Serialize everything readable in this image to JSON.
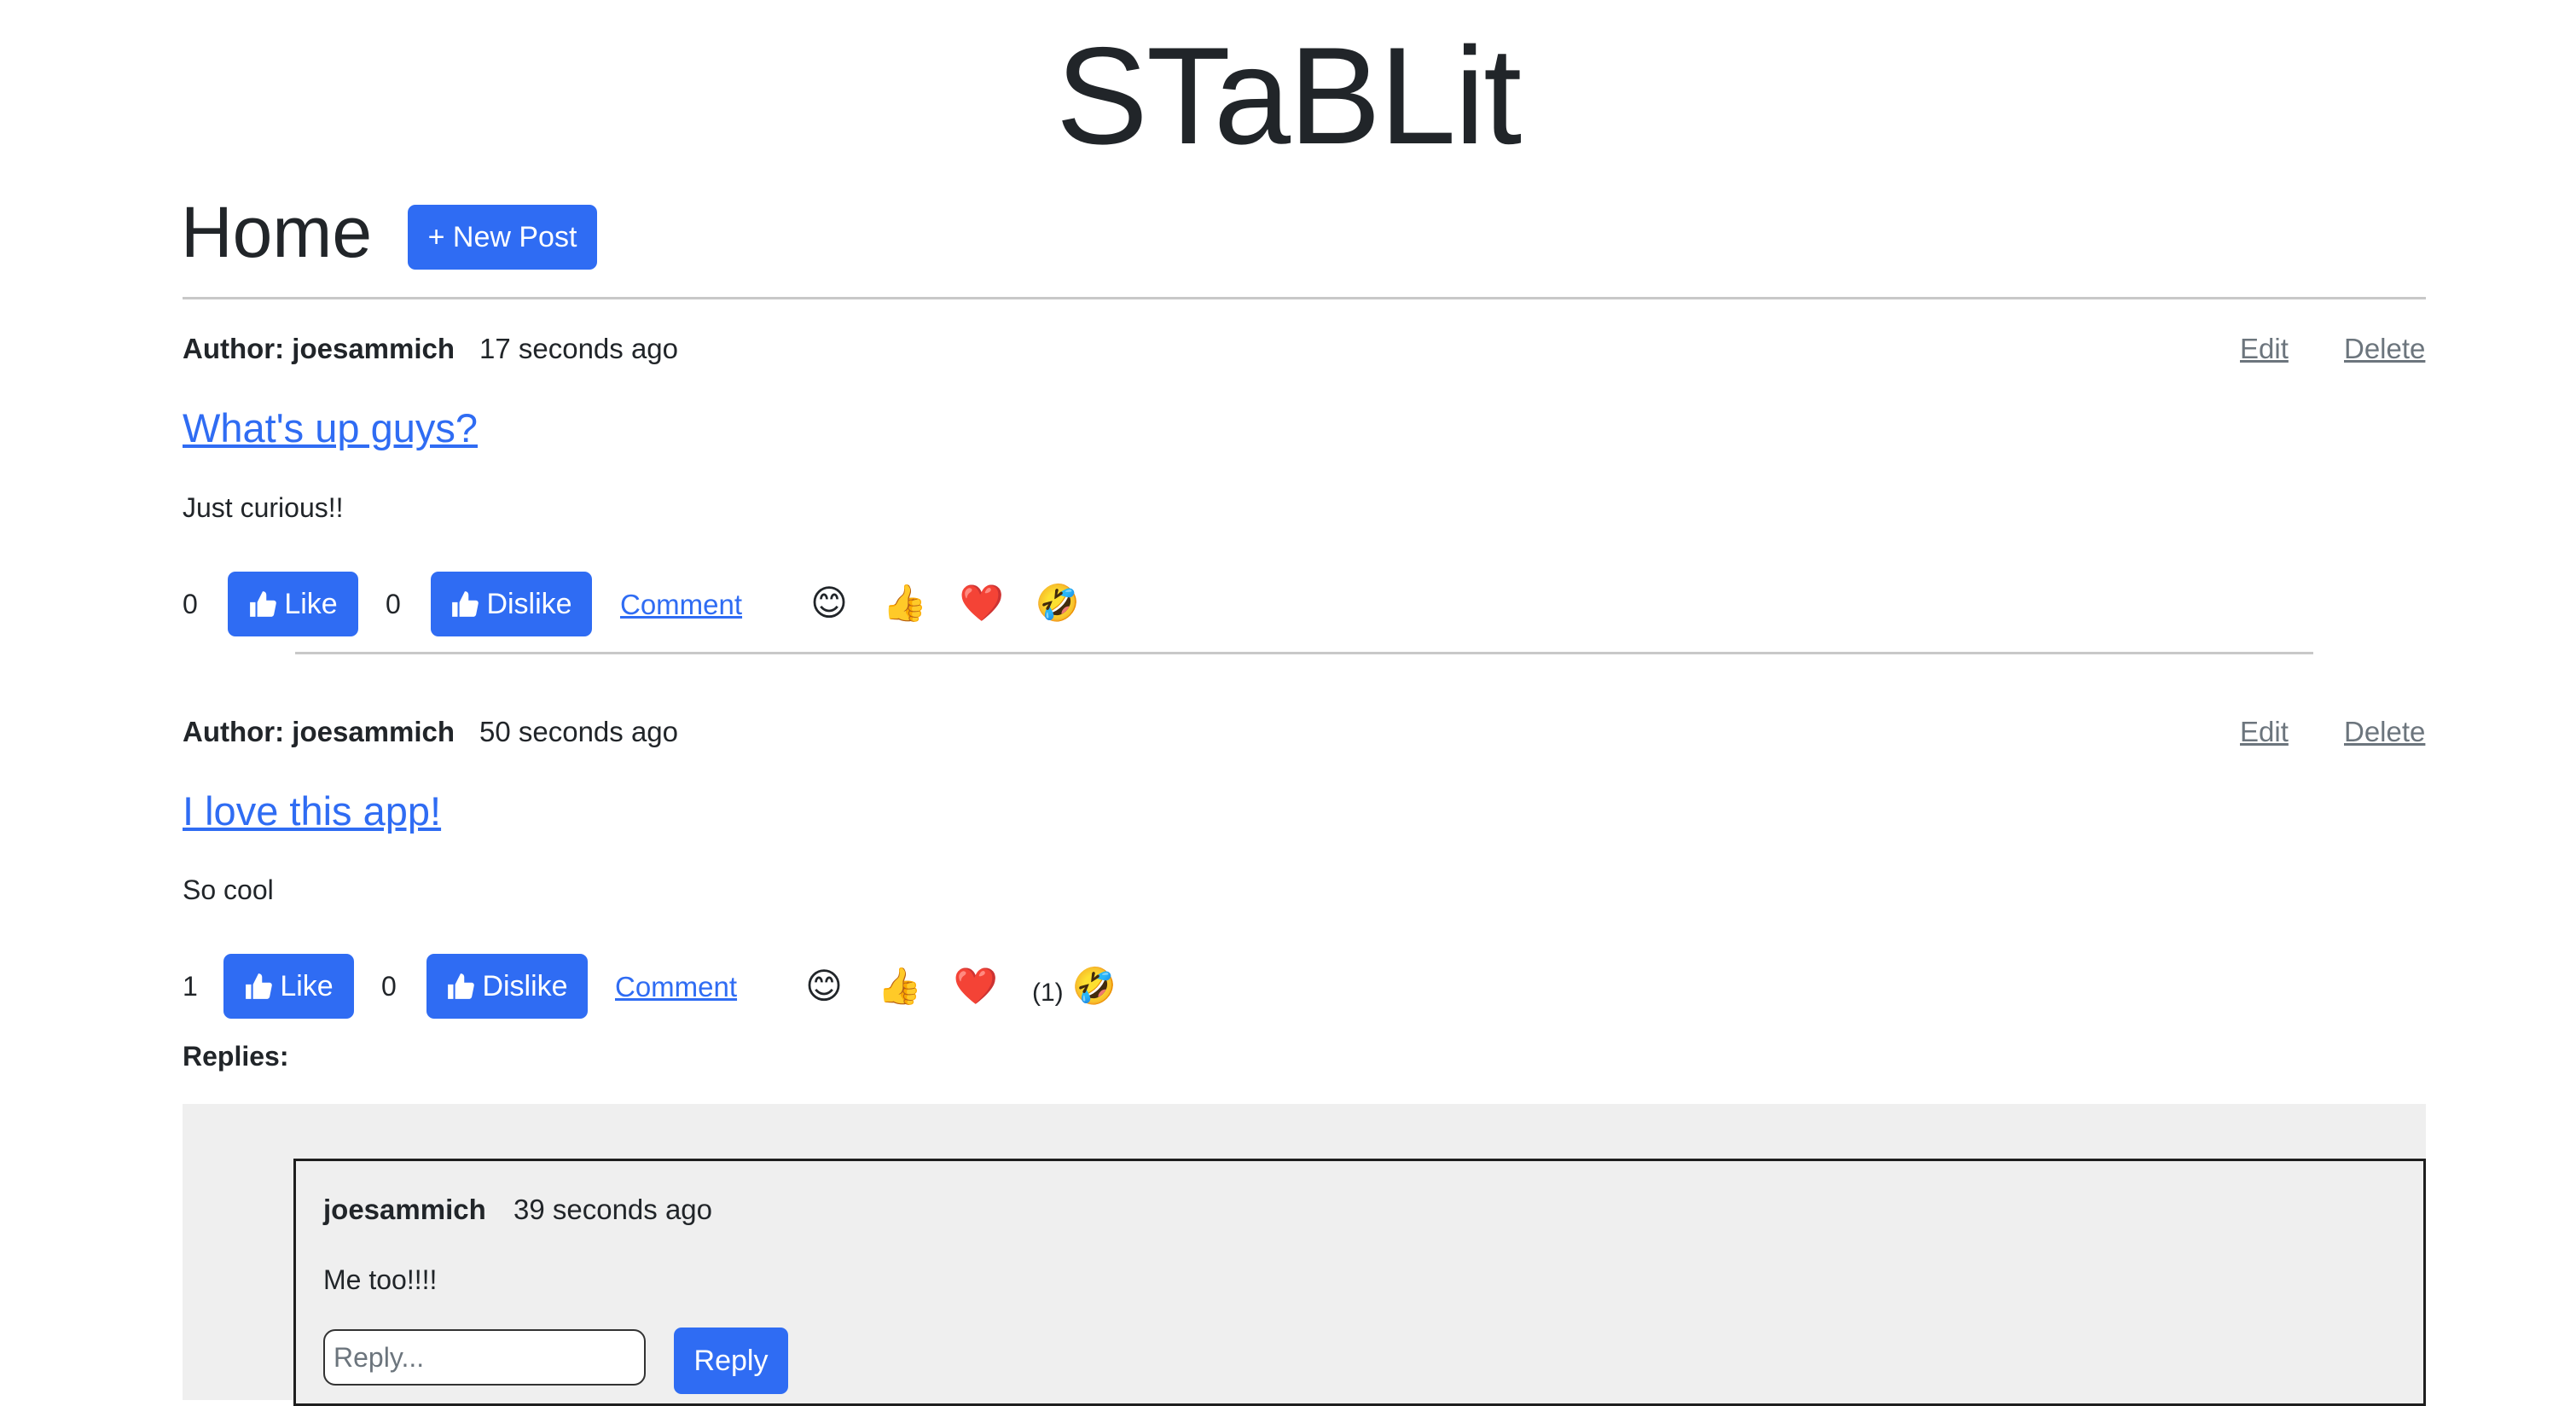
{
  "app": {
    "brand": "STaBLit"
  },
  "header": {
    "title": "Home",
    "new_post_label": "+ New Post"
  },
  "posts": [
    {
      "author_label": "Author: joesammich",
      "time": "17 seconds ago",
      "edit_label": "Edit",
      "delete_label": "Delete",
      "title": "What's up guys?",
      "body": "Just curious!!",
      "like_count": "0",
      "like_label": "Like",
      "dislike_count": "0",
      "dislike_label": "Dislike",
      "comment_label": "Comment",
      "reactions": [
        {
          "icon": "smile-emoji",
          "glyph": "😊",
          "count": ""
        },
        {
          "icon": "thumbs-up-emoji",
          "glyph": "👍",
          "count": ""
        },
        {
          "icon": "heart-emoji",
          "glyph": "❤️",
          "count": ""
        },
        {
          "icon": "rofl-emoji",
          "glyph": "🤣",
          "count": ""
        }
      ]
    },
    {
      "author_label": "Author: joesammich",
      "time": "50 seconds ago",
      "edit_label": "Edit",
      "delete_label": "Delete",
      "title": "I love this app!",
      "body": "So cool",
      "like_count": "1",
      "like_label": "Like",
      "dislike_count": "0",
      "dislike_label": "Dislike",
      "comment_label": "Comment",
      "reactions": [
        {
          "icon": "smile-emoji",
          "glyph": "😊",
          "count": ""
        },
        {
          "icon": "thumbs-up-emoji",
          "glyph": "👍",
          "count": ""
        },
        {
          "icon": "heart-emoji",
          "glyph": "❤️",
          "count": ""
        },
        {
          "icon": "rofl-emoji",
          "glyph": "🤣",
          "count": "(1)"
        }
      ],
      "replies_label": "Replies:",
      "replies": [
        {
          "author": "joesammich",
          "time": "39 seconds ago",
          "body": "Me too!!!!",
          "input_placeholder": "Reply...",
          "reply_button_label": "Reply"
        }
      ]
    }
  ],
  "colors": {
    "primary": "#2f6cf3",
    "muted": "#6c757d",
    "panel": "#efefef"
  }
}
